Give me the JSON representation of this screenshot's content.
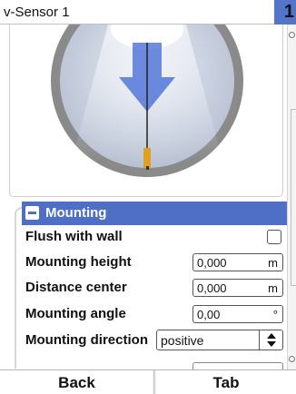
{
  "window": {
    "title": "v-Sensor 1",
    "page_number": "1"
  },
  "section": {
    "title": "Mounting"
  },
  "rows": {
    "flush": {
      "label": "Flush with wall",
      "checked": false
    },
    "height": {
      "label": "Mounting height",
      "value": "0,000",
      "unit": "m"
    },
    "distance": {
      "label": "Distance center",
      "value": "0,000",
      "unit": "m"
    },
    "angle": {
      "label": "Mounting angle",
      "value": "0,00",
      "unit": "°"
    },
    "direction": {
      "label": "Mounting direction",
      "value": "positive"
    }
  },
  "footer": {
    "back_label": "Back",
    "tab_label": "Tab"
  },
  "colors": {
    "accent": "#4f6fc7",
    "badge": "#5474c9",
    "sensor": "#e0a020"
  }
}
